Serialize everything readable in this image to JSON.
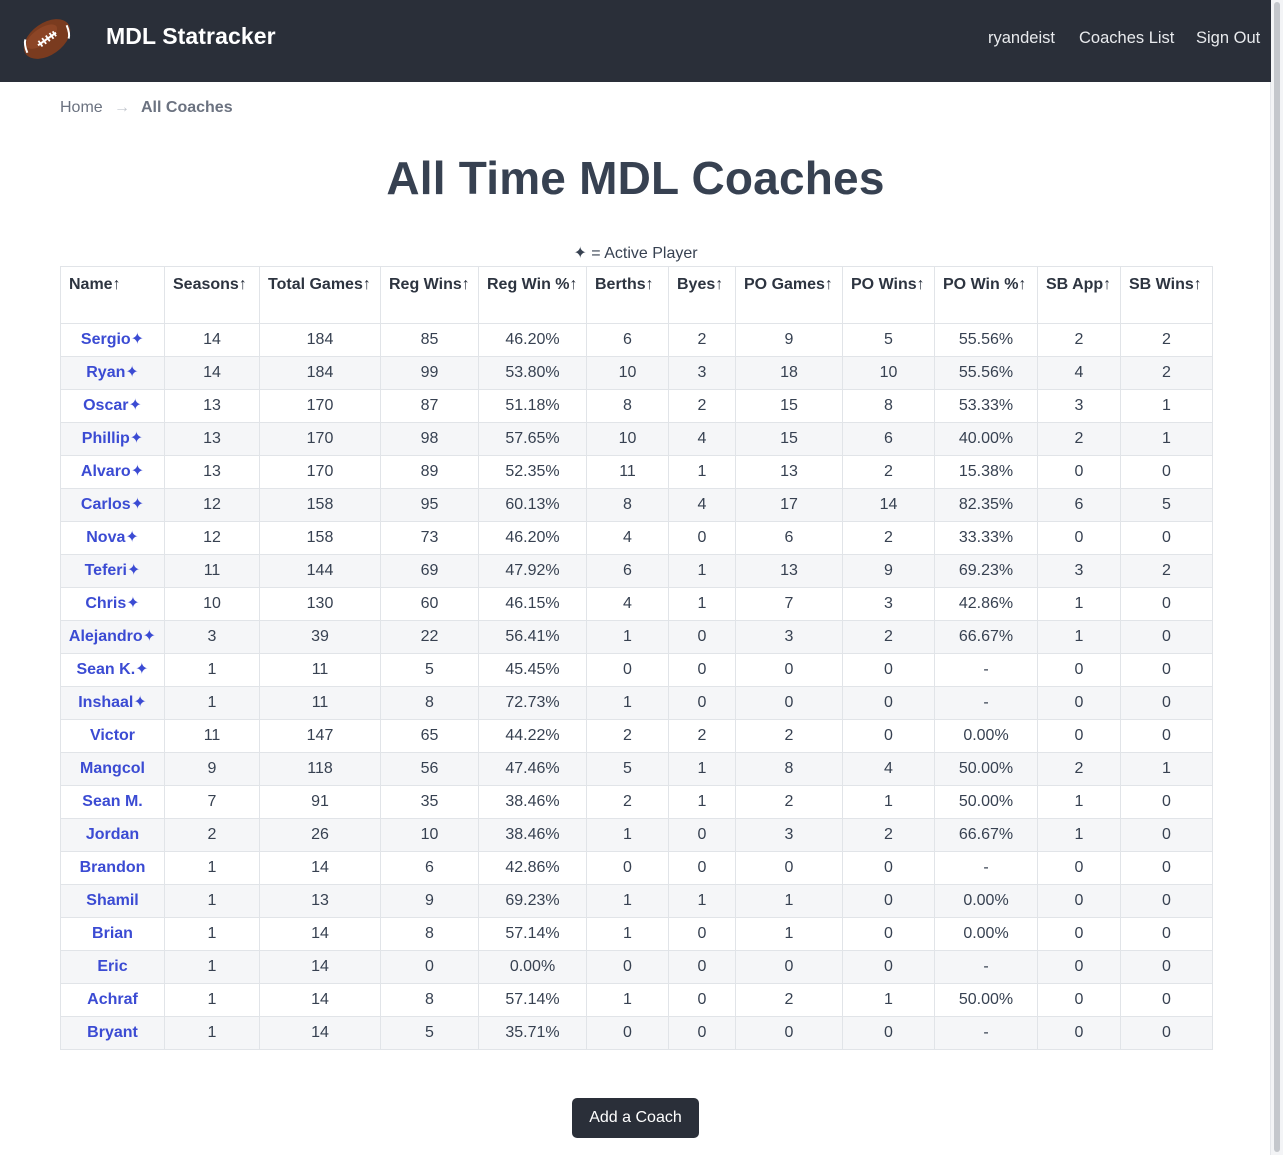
{
  "nav": {
    "brand": "MDL Statracker",
    "user": "ryandeist",
    "coaches_list": "Coaches List",
    "sign_out": "Sign Out"
  },
  "breadcrumb": {
    "home": "Home",
    "separator": "→",
    "current": "All Coaches"
  },
  "page": {
    "title": "All Time MDL Coaches",
    "legend": "✦ = Active Player",
    "add_button": "Add a Coach"
  },
  "table": {
    "columns": [
      "Name↑",
      "Seasons↑",
      "Total Games↑",
      "Reg Wins↑",
      "Reg Win %↑",
      "Berths↑",
      "Byes↑",
      "PO Games↑",
      "PO Wins↑",
      "PO Win %↑",
      "SB App↑",
      "SB Wins↑"
    ],
    "rows": [
      [
        "Sergio✦",
        "14",
        "184",
        "85",
        "46.20%",
        "6",
        "2",
        "9",
        "5",
        "55.56%",
        "2",
        "2"
      ],
      [
        "Ryan✦",
        "14",
        "184",
        "99",
        "53.80%",
        "10",
        "3",
        "18",
        "10",
        "55.56%",
        "4",
        "2"
      ],
      [
        "Oscar✦",
        "13",
        "170",
        "87",
        "51.18%",
        "8",
        "2",
        "15",
        "8",
        "53.33%",
        "3",
        "1"
      ],
      [
        "Phillip✦",
        "13",
        "170",
        "98",
        "57.65%",
        "10",
        "4",
        "15",
        "6",
        "40.00%",
        "2",
        "1"
      ],
      [
        "Alvaro✦",
        "13",
        "170",
        "89",
        "52.35%",
        "11",
        "1",
        "13",
        "2",
        "15.38%",
        "0",
        "0"
      ],
      [
        "Carlos✦",
        "12",
        "158",
        "95",
        "60.13%",
        "8",
        "4",
        "17",
        "14",
        "82.35%",
        "6",
        "5"
      ],
      [
        "Nova✦",
        "12",
        "158",
        "73",
        "46.20%",
        "4",
        "0",
        "6",
        "2",
        "33.33%",
        "0",
        "0"
      ],
      [
        "Teferi✦",
        "11",
        "144",
        "69",
        "47.92%",
        "6",
        "1",
        "13",
        "9",
        "69.23%",
        "3",
        "2"
      ],
      [
        "Chris✦",
        "10",
        "130",
        "60",
        "46.15%",
        "4",
        "1",
        "7",
        "3",
        "42.86%",
        "1",
        "0"
      ],
      [
        "Alejandro✦",
        "3",
        "39",
        "22",
        "56.41%",
        "1",
        "0",
        "3",
        "2",
        "66.67%",
        "1",
        "0"
      ],
      [
        "Sean K.✦",
        "1",
        "11",
        "5",
        "45.45%",
        "0",
        "0",
        "0",
        "0",
        "-",
        "0",
        "0"
      ],
      [
        "Inshaal✦",
        "1",
        "11",
        "8",
        "72.73%",
        "1",
        "0",
        "0",
        "0",
        "-",
        "0",
        "0"
      ],
      [
        "Victor",
        "11",
        "147",
        "65",
        "44.22%",
        "2",
        "2",
        "2",
        "0",
        "0.00%",
        "0",
        "0"
      ],
      [
        "Mangcol",
        "9",
        "118",
        "56",
        "47.46%",
        "5",
        "1",
        "8",
        "4",
        "50.00%",
        "2",
        "1"
      ],
      [
        "Sean M.",
        "7",
        "91",
        "35",
        "38.46%",
        "2",
        "1",
        "2",
        "1",
        "50.00%",
        "1",
        "0"
      ],
      [
        "Jordan",
        "2",
        "26",
        "10",
        "38.46%",
        "1",
        "0",
        "3",
        "2",
        "66.67%",
        "1",
        "0"
      ],
      [
        "Brandon",
        "1",
        "14",
        "6",
        "42.86%",
        "0",
        "0",
        "0",
        "0",
        "-",
        "0",
        "0"
      ],
      [
        "Shamil",
        "1",
        "13",
        "9",
        "69.23%",
        "1",
        "1",
        "1",
        "0",
        "0.00%",
        "0",
        "0"
      ],
      [
        "Brian",
        "1",
        "14",
        "8",
        "57.14%",
        "1",
        "0",
        "1",
        "0",
        "0.00%",
        "0",
        "0"
      ],
      [
        "Eric",
        "1",
        "14",
        "0",
        "0.00%",
        "0",
        "0",
        "0",
        "0",
        "-",
        "0",
        "0"
      ],
      [
        "Achraf",
        "1",
        "14",
        "8",
        "57.14%",
        "1",
        "0",
        "2",
        "1",
        "50.00%",
        "0",
        "0"
      ],
      [
        "Bryant",
        "1",
        "14",
        "5",
        "35.71%",
        "0",
        "0",
        "0",
        "0",
        "-",
        "0",
        "0"
      ]
    ]
  },
  "colors": {
    "navbar": "#2a2f39",
    "link": "#3b4bd3",
    "text": "#374151",
    "stripe": "#f5f6f8"
  },
  "icons": {
    "logo": "football-icon"
  }
}
